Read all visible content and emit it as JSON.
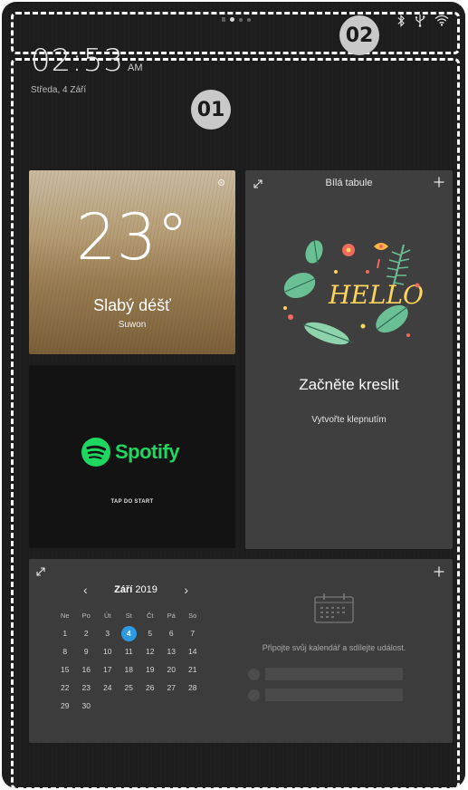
{
  "status_bar": {
    "callout": "02",
    "icons": [
      "bluetooth-icon",
      "usb-icon",
      "wifi-icon"
    ]
  },
  "home": {
    "callout": "01",
    "clock": {
      "time": "02:53",
      "ampm": "AM"
    },
    "date": "Středa, 4 Září"
  },
  "weather": {
    "temperature": "23°",
    "condition": "Slabý déšť",
    "city": "Suwon"
  },
  "spotify": {
    "brand": "Spotify",
    "tap_label": "TAP DO START"
  },
  "whiteboard": {
    "title": "Bílá tabule",
    "art_text": "HELLO",
    "start_label": "Začněte kreslit",
    "sub_label": "Vytvořte klepnutím"
  },
  "calendar": {
    "month": "Září",
    "year": "2019",
    "weekdays": [
      "Ne",
      "Po",
      "Út",
      "St",
      "Čt",
      "Pá",
      "So"
    ],
    "weeks": [
      [
        "1",
        "2",
        "3",
        "4",
        "5",
        "6",
        "7"
      ],
      [
        "8",
        "9",
        "10",
        "11",
        "12",
        "13",
        "14"
      ],
      [
        "15",
        "16",
        "17",
        "18",
        "19",
        "20",
        "21"
      ],
      [
        "22",
        "23",
        "24",
        "25",
        "26",
        "27",
        "28"
      ],
      [
        "29",
        "30",
        "",
        "",
        "",
        "",
        ""
      ]
    ],
    "today": "4",
    "connect_message": "Připojte svůj kalendář a sdílejte událost.",
    "accent": "#2d9be2"
  },
  "colors": {
    "background": "#1d1d1d",
    "card": "#3f3f3f",
    "spotify_green": "#1ed760"
  }
}
